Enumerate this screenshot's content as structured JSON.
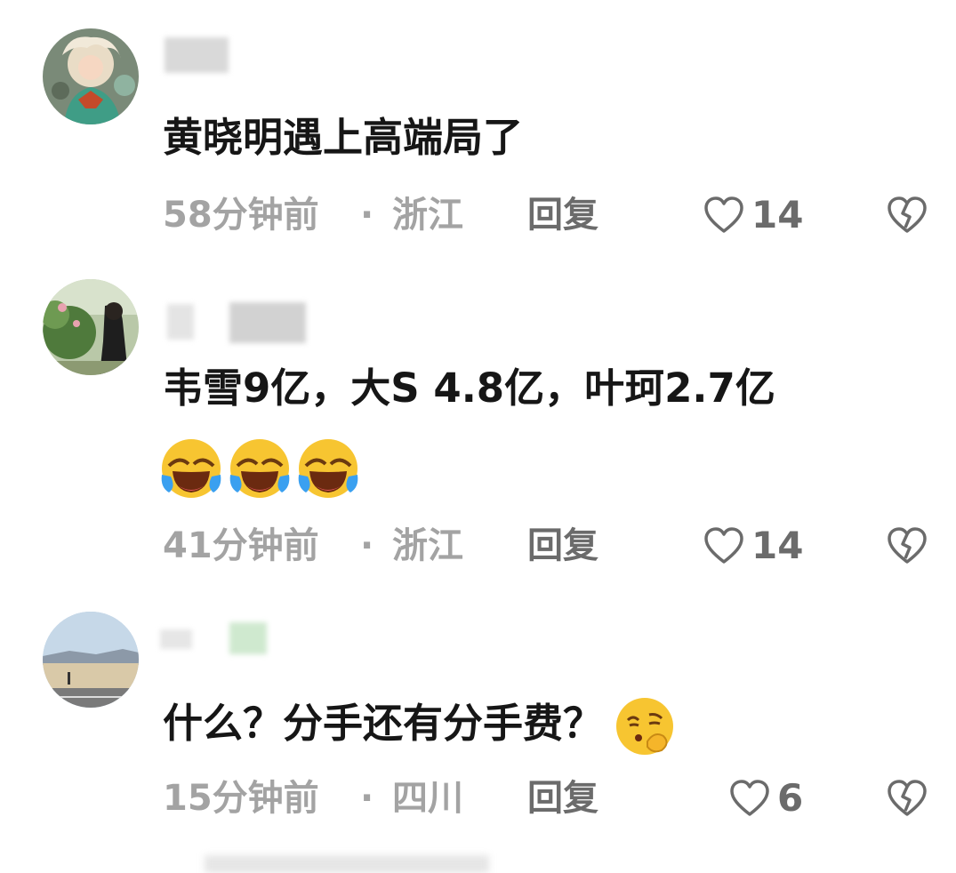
{
  "comments": [
    {
      "text": "黄晓明遇上高端局了",
      "time": "58分钟前",
      "separator": "·",
      "location": "浙江",
      "reply_label": "回复",
      "likes": "14",
      "emoji": []
    },
    {
      "text": "韦雪9亿，大S 4.8亿，叶珂2.7亿",
      "time": "41分钟前",
      "separator": "·",
      "location": "浙江",
      "reply_label": "回复",
      "likes": "14",
      "emoji": [
        "face-with-tears-of-joy",
        "face-with-tears-of-joy",
        "face-with-tears-of-joy"
      ]
    },
    {
      "text": "什么？分手还有分手费？",
      "time": "15分钟前",
      "separator": "·",
      "location": "四川",
      "reply_label": "回复",
      "likes": "6",
      "emoji": [
        "face-shushing-thinking"
      ]
    }
  ],
  "icons": {
    "like": "heart-outline-icon",
    "dislike": "broken-heart-outline-icon"
  },
  "colors": {
    "text": "#161616",
    "meta": "#a3a3a3",
    "reply": "#6b6b6b",
    "icon": "#6b6b6b"
  }
}
